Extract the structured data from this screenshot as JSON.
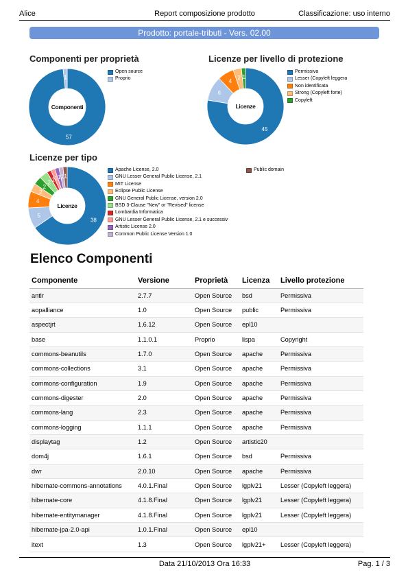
{
  "header": {
    "left": "Alice",
    "center": "Report composizione prodotto",
    "right": "Classificazione: uso interno"
  },
  "banner": "Prodotto: portale-tributi - Vers. 02.00",
  "chart_data": [
    {
      "type": "pie",
      "title": "Componenti per proprietà",
      "center_label": "Componenti",
      "categories": [
        "Open source",
        "Proprio"
      ],
      "values": [
        57,
        1
      ],
      "colors": [
        "#1f77b4",
        "#aec7e8"
      ]
    },
    {
      "type": "pie",
      "title": "Licenze per livello di protezione",
      "center_label": "Licenze",
      "categories": [
        "Permissiva",
        "Lesser (Copyleft leggera",
        "Non identificata",
        "Strong (Copyleft forte)",
        "Copyleft"
      ],
      "values": [
        45,
        6,
        4,
        2,
        1
      ],
      "colors": [
        "#1f77b4",
        "#aec7e8",
        "#ff7f0e",
        "#ffbb78",
        "#2ca02c"
      ]
    },
    {
      "type": "pie",
      "title": "Licenze per tipo",
      "center_label": "Licenze",
      "categories": [
        "Apache License, 2.0",
        "GNU Lesser General Public License, 2.1",
        "MIT License",
        "Eclipse Public License",
        "GNU General Public License, version 2.0",
        "BSD 3-Clause \"New\" or \"Revised\" license",
        "Lombardia Informatica",
        "GNU Lesser General Public License, 2.1 e successiv",
        "Artistic License 2.0",
        "Common Public License Version 1.0",
        "Public domain"
      ],
      "values": [
        38,
        5,
        4,
        2,
        2,
        2,
        1,
        1,
        1,
        1,
        1
      ],
      "colors": [
        "#1f77b4",
        "#aec7e8",
        "#ff7f0e",
        "#ffbb78",
        "#2ca02c",
        "#98df8a",
        "#d62728",
        "#ff9896",
        "#9467bd",
        "#c5b0d5",
        "#8c564b"
      ]
    }
  ],
  "list_title": "Elenco Componenti",
  "table": {
    "headers": [
      "Componente",
      "Versione",
      "Proprietà",
      "Licenza",
      "Livello protezione"
    ],
    "rows": [
      [
        "antlr",
        "2.7.7",
        "Open Source",
        "bsd",
        "Permissiva"
      ],
      [
        "aopalliance",
        "1.0",
        "Open Source",
        "public",
        "Permissiva"
      ],
      [
        "aspectjrt",
        "1.6.12",
        "Open Source",
        "epl10",
        ""
      ],
      [
        "base",
        "1.1.0.1",
        "Proprio",
        "lispa",
        "Copyright"
      ],
      [
        "commons-beanutils",
        "1.7.0",
        "Open Source",
        "apache",
        "Permissiva"
      ],
      [
        "commons-collections",
        "3.1",
        "Open Source",
        "apache",
        "Permissiva"
      ],
      [
        "commons-configuration",
        "1.9",
        "Open Source",
        "apache",
        "Permissiva"
      ],
      [
        "commons-digester",
        "2.0",
        "Open Source",
        "apache",
        "Permissiva"
      ],
      [
        "commons-lang",
        "2.3",
        "Open Source",
        "apache",
        "Permissiva"
      ],
      [
        "commons-logging",
        "1.1.1",
        "Open Source",
        "apache",
        "Permissiva"
      ],
      [
        "displaytag",
        "1.2",
        "Open Source",
        "artistic20",
        ""
      ],
      [
        "dom4j",
        "1.6.1",
        "Open Source",
        "bsd",
        "Permissiva"
      ],
      [
        "dwr",
        "2.0.10",
        "Open Source",
        "apache",
        "Permissiva"
      ],
      [
        "hibernate-commons-annotations",
        "4.0.1.Final",
        "Open Source",
        "lgplv21",
        "Lesser (Copyleft leggera)"
      ],
      [
        "hibernate-core",
        "4.1.8.Final",
        "Open Source",
        "lgplv21",
        "Lesser (Copyleft leggera)"
      ],
      [
        "hibernate-entitymanager",
        "4.1.8.Final",
        "Open Source",
        "lgplv21",
        "Lesser (Copyleft leggera)"
      ],
      [
        "hibernate-jpa-2.0-api",
        "1.0.1.Final",
        "Open Source",
        "epl10",
        ""
      ],
      [
        "itext",
        "1.3",
        "Open Source",
        "lgplv21+",
        "Lesser (Copyleft leggera)"
      ]
    ]
  },
  "footer": {
    "center": "Data 21/10/2013    Ora 16:33",
    "right": "Pag. 1 / 3"
  }
}
